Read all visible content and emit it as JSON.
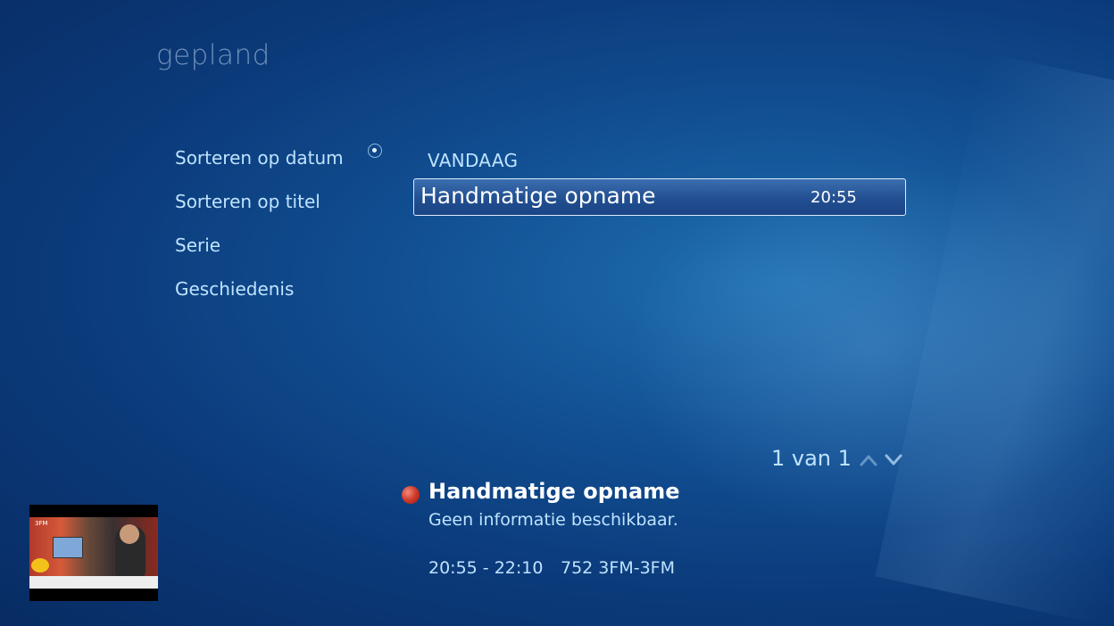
{
  "page": {
    "title": "gepland"
  },
  "sort_menu": {
    "items": [
      {
        "label": "Sorteren op datum",
        "selected": true
      },
      {
        "label": "Sorteren op titel"
      },
      {
        "label": "Serie"
      },
      {
        "label": "Geschiedenis"
      }
    ]
  },
  "schedule": {
    "group_header": "VANDAAG",
    "rows": [
      {
        "title": "Handmatige opname",
        "time": "20:55",
        "selected": true
      }
    ]
  },
  "pager": {
    "text": "1 van 1"
  },
  "details": {
    "status_color": "#d0392a",
    "title": "Handmatige opname",
    "description": "Geen informatie beschikbaar.",
    "time_range": "20:55 - 22:10",
    "channel": "752 3FM-3FM"
  },
  "preview": {
    "logo_text": "3FM"
  },
  "icons": {
    "radio": "radio-selected-icon",
    "up": "chevron-up-icon",
    "down": "chevron-down-icon",
    "record": "record-dot-icon"
  }
}
